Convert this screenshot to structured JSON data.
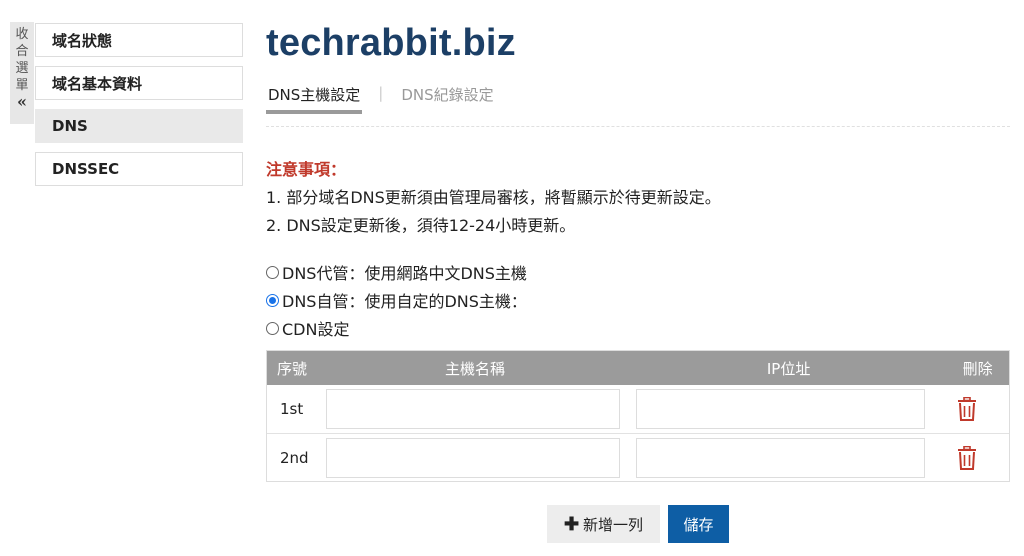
{
  "collapse_menu": {
    "chars": [
      "收",
      "合",
      "選",
      "單"
    ],
    "chevron": "«"
  },
  "sidebar": {
    "items": [
      {
        "label": "域名狀態"
      },
      {
        "label": "域名基本資料"
      },
      {
        "label": "DNS"
      },
      {
        "label": "DNSSEC"
      }
    ]
  },
  "header": {
    "title": "techrabbit.biz"
  },
  "tabs": [
    {
      "label": "DNS主機設定"
    },
    {
      "label": "DNS紀錄設定"
    }
  ],
  "tab_separator": "|",
  "notice": {
    "title": "注意事項：",
    "lines": [
      "1. 部分域名DNS更新須由管理局審核，將暫顯示於待更新設定。",
      "2. DNS設定更新後，須待12-24小時更新。"
    ]
  },
  "options": [
    {
      "label": "DNS代管：使用網路中文DNS主機",
      "checked": false
    },
    {
      "label": "DNS自管：使用自定的DNS主機：",
      "checked": true
    },
    {
      "label": "CDN設定",
      "checked": false
    }
  ],
  "table": {
    "headers": [
      "序號",
      "主機名稱",
      "IP位址",
      "刪除"
    ],
    "rows": [
      {
        "seq": "1st",
        "host": "",
        "ip": ""
      },
      {
        "seq": "2nd",
        "host": "",
        "ip": ""
      }
    ]
  },
  "actions": {
    "add_row": "新增一列",
    "add_icon": "plus-icon",
    "save": "儲存"
  },
  "colors": {
    "title": "#1c3f66",
    "notice": "#c0392b",
    "save_button": "#0e5ea5",
    "table_header": "#9b9b9b",
    "delete_icon": "#c0392b"
  }
}
